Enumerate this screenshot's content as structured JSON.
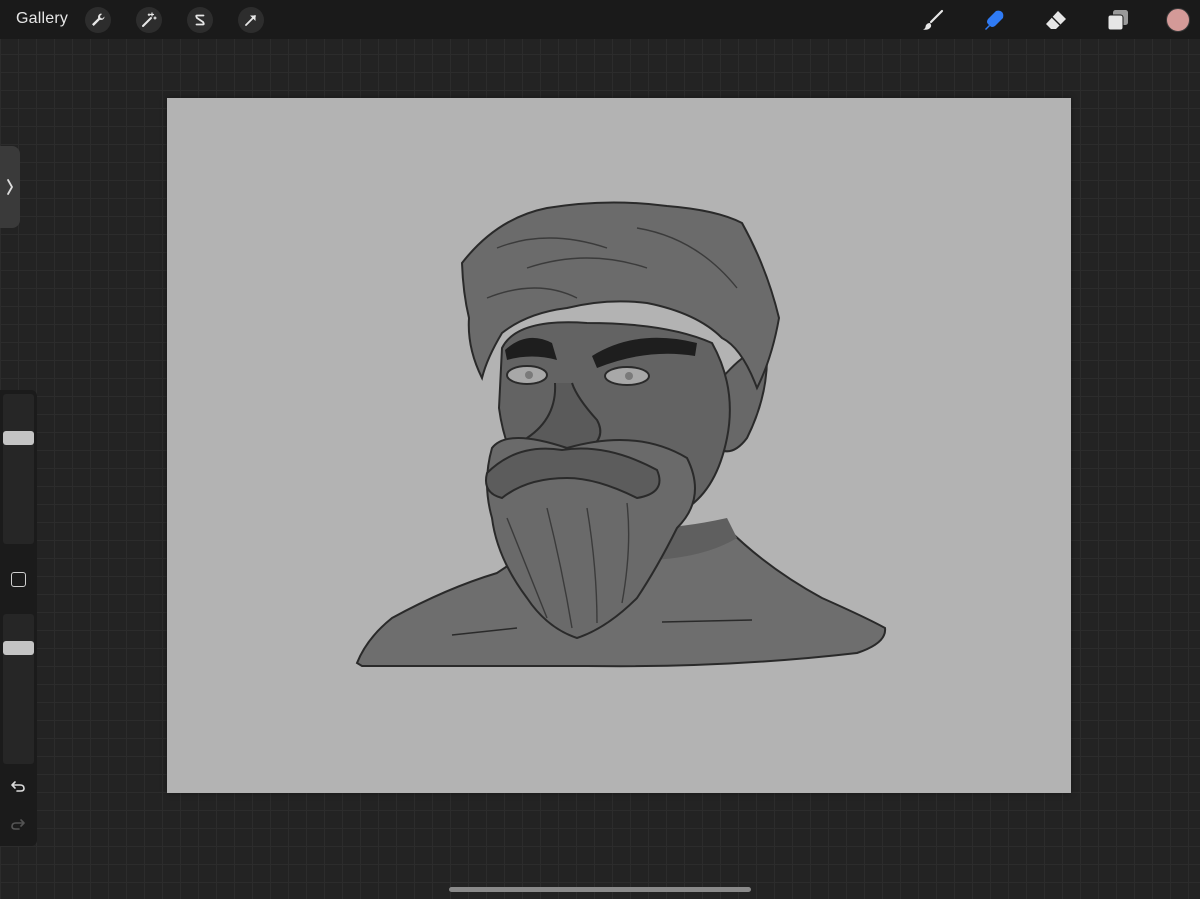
{
  "topbar": {
    "gallery_label": "Gallery",
    "left_tools": [
      "wrench-icon",
      "magic-wand-icon",
      "selection-icon",
      "transform-arrow-icon"
    ],
    "right_tools": [
      "brush-icon",
      "smudge-icon",
      "eraser-icon",
      "layers-icon"
    ],
    "active_tool": "smudge-icon",
    "active_color": "#d49a98",
    "accent_color": "#2f7bf5"
  },
  "sidebar": {
    "brush_size_level": 0.73,
    "opacity_level": 0.8
  },
  "canvas": {
    "background": "#b3b3b3"
  }
}
